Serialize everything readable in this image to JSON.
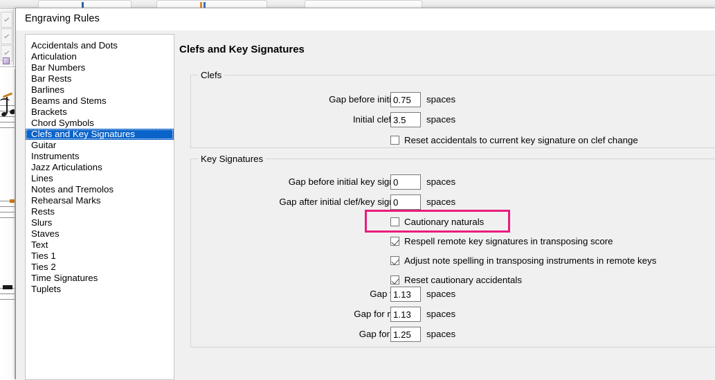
{
  "app": {
    "ribbon_tabs": [
      "",
      "",
      ""
    ],
    "left_toolbar_buttons": [
      "tool-check-1",
      "tool-check-2",
      "tool-check-3"
    ]
  },
  "dialog": {
    "title": "Engraving Rules"
  },
  "sidebar": {
    "items": [
      {
        "label": "Accidentals and Dots",
        "selected": false
      },
      {
        "label": "Articulation",
        "selected": false
      },
      {
        "label": "Bar Numbers",
        "selected": false
      },
      {
        "label": "Bar Rests",
        "selected": false
      },
      {
        "label": "Barlines",
        "selected": false
      },
      {
        "label": "Beams and Stems",
        "selected": false
      },
      {
        "label": "Brackets",
        "selected": false
      },
      {
        "label": "Chord Symbols",
        "selected": false
      },
      {
        "label": "Clefs and Key Signatures",
        "selected": true
      },
      {
        "label": "Guitar",
        "selected": false
      },
      {
        "label": "Instruments",
        "selected": false
      },
      {
        "label": "Jazz Articulations",
        "selected": false
      },
      {
        "label": "Lines",
        "selected": false
      },
      {
        "label": "Notes and Tremolos",
        "selected": false
      },
      {
        "label": "Rehearsal Marks",
        "selected": false
      },
      {
        "label": "Rests",
        "selected": false
      },
      {
        "label": "Slurs",
        "selected": false
      },
      {
        "label": "Staves",
        "selected": false
      },
      {
        "label": "Text",
        "selected": false
      },
      {
        "label": "Ties 1",
        "selected": false
      },
      {
        "label": "Ties 2",
        "selected": false
      },
      {
        "label": "Time Signatures",
        "selected": false
      },
      {
        "label": "Tuplets",
        "selected": false
      }
    ]
  },
  "pane": {
    "heading": "Clefs and Key Signatures",
    "clefs": {
      "group_label": "Clefs",
      "gap_before_initial_clef": {
        "label": "Gap before initial clef",
        "value": "0.75",
        "units": "spaces"
      },
      "initial_clef_width": {
        "label": "Initial clef width",
        "value": "3.5",
        "units": "spaces"
      },
      "reset_accidentals": {
        "label": "Reset accidentals to current key signature on clef change",
        "checked": false
      }
    },
    "key_signatures": {
      "group_label": "Key Signatures",
      "gap_before_initial_key_signature": {
        "label": "Gap before initial key signature",
        "value": "0",
        "units": "spaces"
      },
      "gap_after_initial_clef_key_signature": {
        "label": "Gap after initial clef/key signature",
        "value": "0",
        "units": "spaces"
      },
      "cautionary_naturals": {
        "label": "Cautionary naturals",
        "checked": false,
        "highlighted": true
      },
      "respell_remote": {
        "label": "Respell remote key signatures in transposing score",
        "checked": true
      },
      "adjust_note_spelling": {
        "label": "Adjust note spelling in transposing instruments in remote keys",
        "checked": true
      },
      "reset_cautionary_accidentals": {
        "label": "Reset cautionary accidentals",
        "checked": true
      },
      "gap_for_flat": {
        "label": "Gap for flat",
        "value": "1.13",
        "units": "spaces"
      },
      "gap_for_natural": {
        "label": "Gap for natural",
        "value": "1.13",
        "units": "spaces"
      },
      "gap_for_sharp": {
        "label": "Gap for sharp",
        "value": "1.25",
        "units": "spaces"
      }
    }
  },
  "colors": {
    "selection_blue": "#0a63c9",
    "highlight_pink": "#ea1b7d",
    "dialog_face": "#f0f0f0"
  }
}
